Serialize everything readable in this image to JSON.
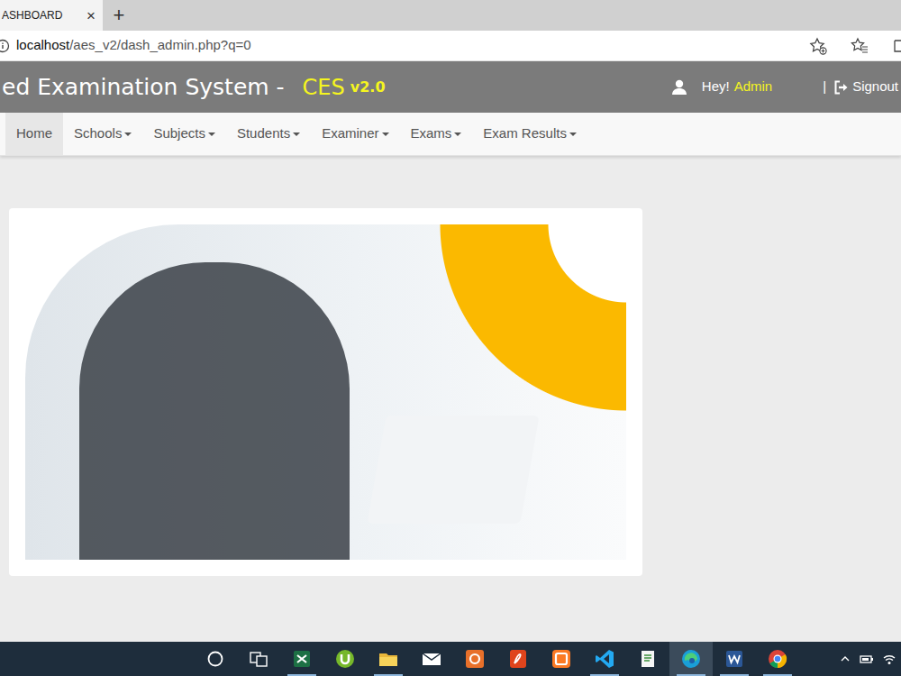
{
  "browser": {
    "tab": {
      "title": "ASHBOARD",
      "close": "×"
    },
    "new_tab": "+",
    "address": {
      "host": "localhost",
      "path": "/aes_v2/dash_admin.php?q=0"
    }
  },
  "header": {
    "title": "ed Examination System -",
    "brand": "CES",
    "version": "v2.0",
    "greeting": "Hey!",
    "user": "Admin",
    "separator": "|",
    "signout": "Signout"
  },
  "nav": {
    "items": [
      {
        "label": "Home",
        "selected": true,
        "dropdown": false
      },
      {
        "label": "Schools",
        "selected": false,
        "dropdown": true
      },
      {
        "label": "Subjects",
        "selected": false,
        "dropdown": true
      },
      {
        "label": "Students",
        "selected": false,
        "dropdown": true
      },
      {
        "label": "Examiner",
        "selected": false,
        "dropdown": true
      },
      {
        "label": "Exams",
        "selected": false,
        "dropdown": true
      },
      {
        "label": "Exam Results",
        "selected": false,
        "dropdown": true
      }
    ]
  },
  "taskbar": {
    "apps": [
      {
        "running": false,
        "selected": false
      },
      {
        "running": false,
        "selected": false
      },
      {
        "running": true,
        "selected": false
      },
      {
        "running": false,
        "selected": false
      },
      {
        "running": true,
        "selected": false
      },
      {
        "running": false,
        "selected": false
      },
      {
        "running": false,
        "selected": false
      },
      {
        "running": false,
        "selected": false
      },
      {
        "running": false,
        "selected": false
      },
      {
        "running": true,
        "selected": false
      },
      {
        "running": false,
        "selected": false
      },
      {
        "running": true,
        "selected": true
      },
      {
        "running": true,
        "selected": false
      },
      {
        "running": true,
        "selected": false
      }
    ]
  }
}
